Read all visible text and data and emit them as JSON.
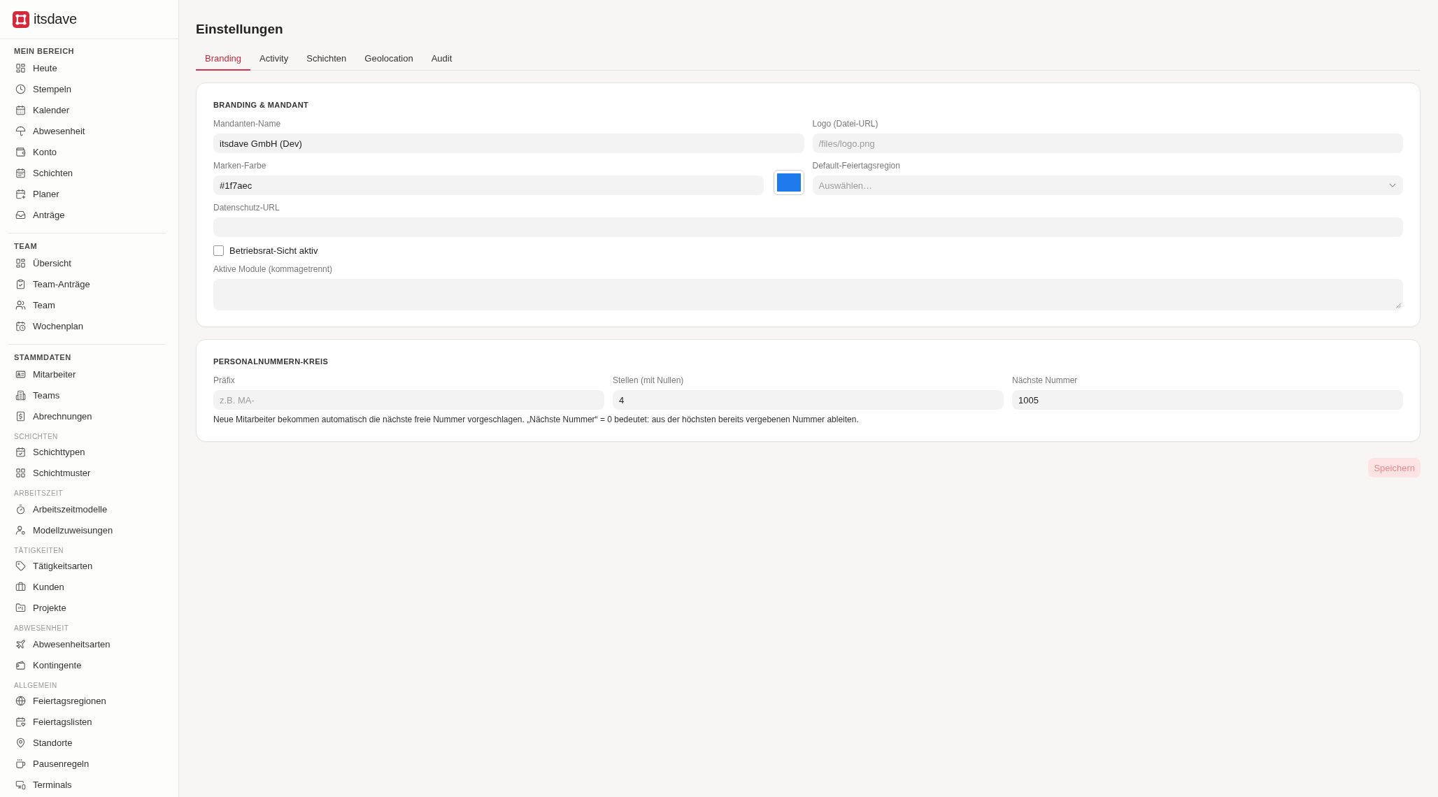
{
  "sidebar": {
    "brand": "itsdave",
    "sections": [
      {
        "kind": "group",
        "title": "MEIN BEREICH",
        "items": [
          {
            "label": "Heute",
            "selected": false
          },
          {
            "label": "Stempeln",
            "selected": false
          },
          {
            "label": "Kalender",
            "selected": false
          },
          {
            "label": "Abwesenheit",
            "selected": false
          },
          {
            "label": "Konto",
            "selected": false
          },
          {
            "label": "Schichten",
            "selected": false
          },
          {
            "label": "Planer",
            "selected": false
          },
          {
            "label": "Anträge",
            "selected": false
          }
        ]
      },
      {
        "kind": "group",
        "title": "TEAM",
        "items": [
          {
            "label": "Übersicht",
            "selected": false
          },
          {
            "label": "Team-Anträge",
            "selected": false
          },
          {
            "label": "Team",
            "selected": false
          },
          {
            "label": "Wochenplan",
            "selected": false
          }
        ]
      },
      {
        "kind": "group",
        "title": "STAMMDATEN",
        "items": [
          {
            "label": "Mitarbeiter",
            "selected": false
          },
          {
            "label": "Teams",
            "selected": false
          },
          {
            "label": "Abrechnungen",
            "selected": false
          }
        ]
      },
      {
        "kind": "subgroup",
        "title": "SCHICHTEN",
        "items": [
          {
            "label": "Schichttypen",
            "selected": false
          },
          {
            "label": "Schichtmuster",
            "selected": false
          }
        ]
      },
      {
        "kind": "subgroup",
        "title": "ARBEITSZEIT",
        "items": [
          {
            "label": "Arbeitszeitmodelle",
            "selected": false
          },
          {
            "label": "Modellzuweisungen",
            "selected": false
          }
        ]
      },
      {
        "kind": "subgroup",
        "title": "TÄTIGKEITEN",
        "items": [
          {
            "label": "Tätigkeitsarten",
            "selected": false
          },
          {
            "label": "Kunden",
            "selected": false
          },
          {
            "label": "Projekte",
            "selected": false
          }
        ]
      },
      {
        "kind": "subgroup",
        "title": "ABWESENHEIT",
        "items": [
          {
            "label": "Abwesenheitsarten",
            "selected": false
          },
          {
            "label": "Kontingente",
            "selected": false
          }
        ]
      },
      {
        "kind": "subgroup",
        "title": "ALLGEMEIN",
        "items": [
          {
            "label": "Feiertagsregionen",
            "selected": false
          },
          {
            "label": "Feiertagslisten",
            "selected": false
          },
          {
            "label": "Standorte",
            "selected": false
          },
          {
            "label": "Pausenregeln",
            "selected": false
          },
          {
            "label": "Terminals",
            "selected": false
          }
        ]
      }
    ]
  },
  "page": {
    "title": "Einstellungen",
    "tabs": [
      {
        "label": "Branding",
        "selected": true
      },
      {
        "label": "Activity",
        "selected": false
      },
      {
        "label": "Schichten",
        "selected": false
      },
      {
        "label": "Geolocation",
        "selected": false
      },
      {
        "label": "Audit",
        "selected": false
      }
    ],
    "cards": [
      {
        "title": "BRANDING & MANDANT",
        "rows": [
          [
            {
              "kind": "text",
              "label": "Mandanten-Name",
              "value": "itsdave GmbH (Dev)"
            },
            {
              "kind": "text",
              "label": "Logo (Datei-URL)",
              "placeholder": "/files/logo.png"
            }
          ],
          [
            {
              "kind": "color",
              "label": "Marken-Farbe",
              "value": "#1f7aec",
              "color": "#1f7aec"
            },
            {
              "kind": "select",
              "label": "Default-Feiertagsregion",
              "placeholder": "Auswählen…"
            }
          ],
          [
            {
              "kind": "text",
              "label": "Datenschutz-URL"
            }
          ],
          [
            {
              "kind": "checkbox",
              "label": "Betriebsrat-Sicht aktiv",
              "checked": false
            }
          ],
          [
            {
              "kind": "textarea",
              "label": "Aktive Module (kommagetrennt)"
            }
          ]
        ]
      },
      {
        "title": "PERSONALNUMMERN-KREIS",
        "rows": [
          [
            {
              "kind": "text",
              "label": "Präfix",
              "placeholder": "z.B. MA-"
            },
            {
              "kind": "text",
              "label": "Stellen (mit Nullen)",
              "value": "4"
            },
            {
              "kind": "text",
              "label": "Nächste Nummer",
              "value": "1005"
            }
          ]
        ],
        "note": "Neue Mitarbeiter bekommen automatisch die nächste freie Nummer vorgeschlagen. „Nächste Nummer“ = 0 bedeutet: aus der höchsten bereits vergebenen Nummer ableiten."
      }
    ],
    "save_button": {
      "label": "Speichern",
      "disabled": true
    }
  }
}
